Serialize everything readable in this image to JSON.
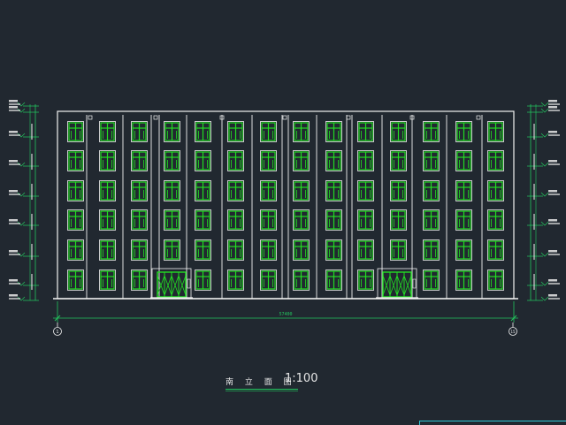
{
  "drawing": {
    "title": "南 立 面 图",
    "scale": "1:100",
    "total_dimension": "57400",
    "axis_left": "1",
    "axis_right": "15"
  },
  "elevation": {
    "floors": 6,
    "columns": 14,
    "entrance_columns": [
      3,
      10
    ]
  },
  "colors": {
    "background": "#212830",
    "outline": "#f2f2f2",
    "window": "#22dd22",
    "dimension": "#22c55e",
    "level_text": "#e8e8e8",
    "frame": "#33c8d8"
  }
}
